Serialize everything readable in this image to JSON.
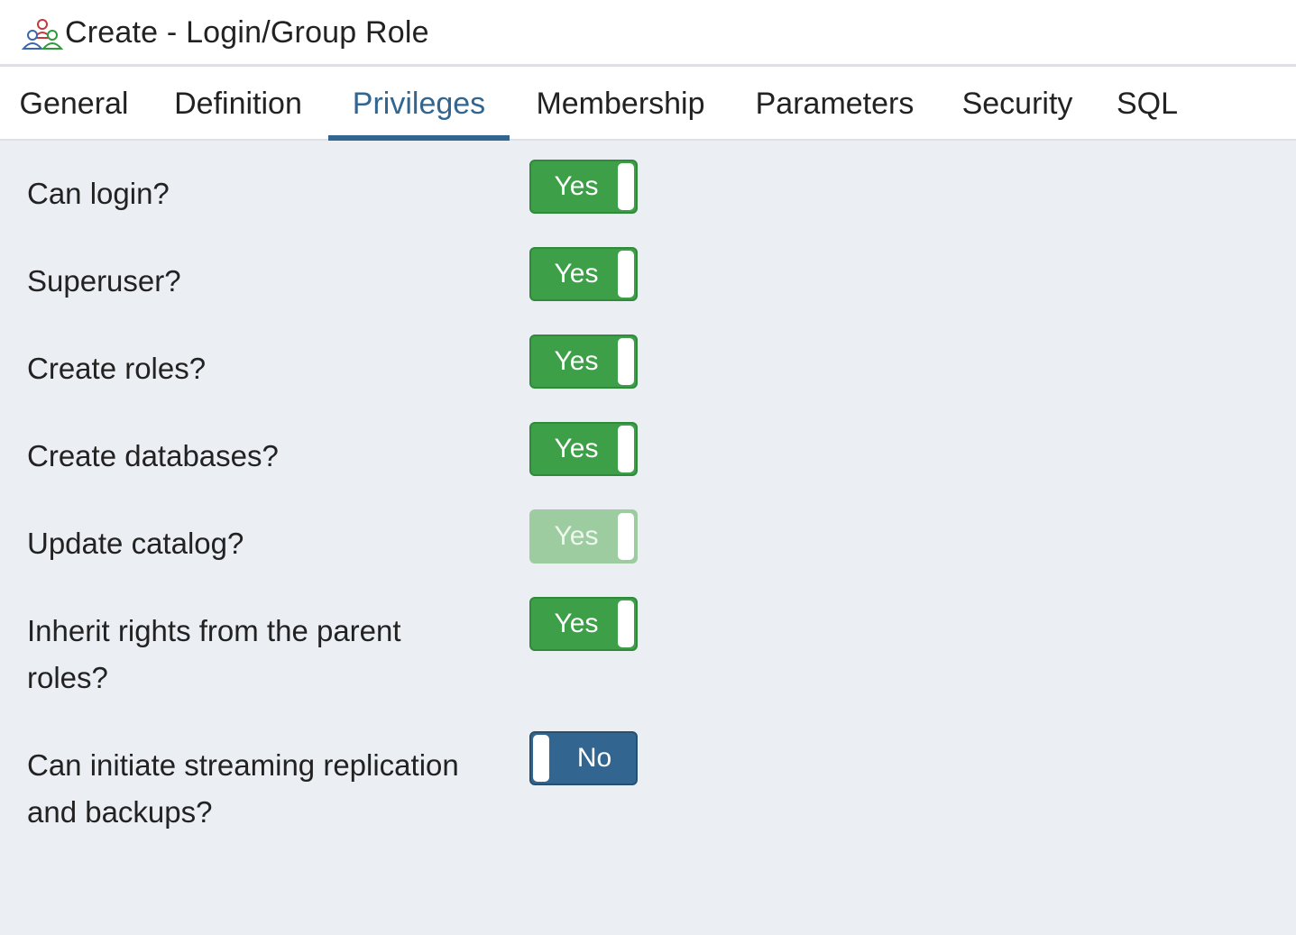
{
  "dialog": {
    "title": "Create - Login/Group Role",
    "icon": "login-group-role-icon"
  },
  "tabs": [
    {
      "label": "General",
      "active": false
    },
    {
      "label": "Definition",
      "active": false
    },
    {
      "label": "Privileges",
      "active": true
    },
    {
      "label": "Membership",
      "active": false
    },
    {
      "label": "Parameters",
      "active": false
    },
    {
      "label": "Security",
      "active": false
    },
    {
      "label": "SQL",
      "active": false
    }
  ],
  "privileges": [
    {
      "label": "Can login?",
      "value": "Yes",
      "on": true,
      "disabled": false
    },
    {
      "label": "Superuser?",
      "value": "Yes",
      "on": true,
      "disabled": false
    },
    {
      "label": "Create roles?",
      "value": "Yes",
      "on": true,
      "disabled": false
    },
    {
      "label": "Create databases?",
      "value": "Yes",
      "on": true,
      "disabled": false
    },
    {
      "label": "Update catalog?",
      "value": "Yes",
      "on": true,
      "disabled": true
    },
    {
      "label": "Inherit rights from the parent roles?",
      "value": "Yes",
      "on": true,
      "disabled": false
    },
    {
      "label": "Can initiate streaming replication and backups?",
      "value": "No",
      "on": false,
      "disabled": false
    }
  ],
  "colors": {
    "accent": "#326690",
    "switch_on": "#3d9f48",
    "switch_on_disabled": "#9ccc9f",
    "switch_off": "#326690",
    "panel_bg": "#ebeef3"
  }
}
